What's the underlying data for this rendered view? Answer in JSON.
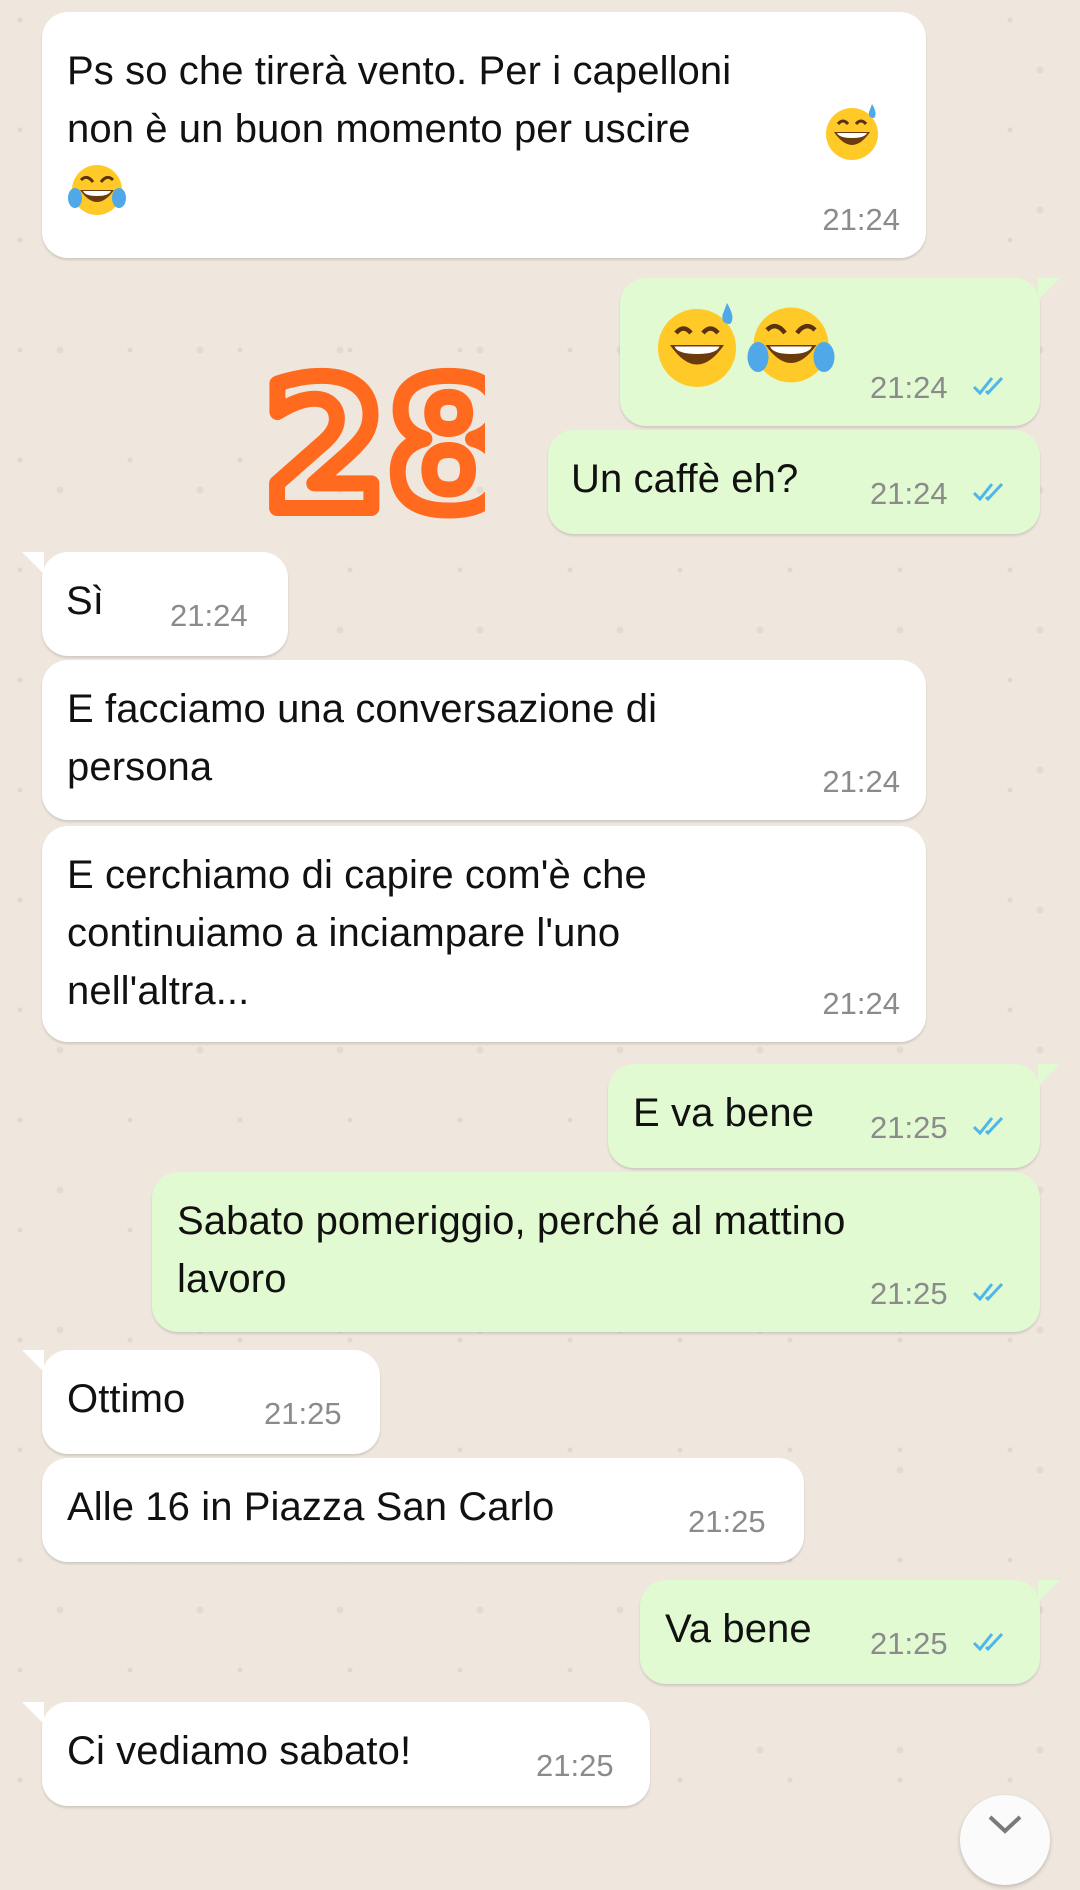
{
  "messages": [
    {
      "direction": "in",
      "text": "Ps so che tirerà vento. Per i capelloni\nnon è un buon momento per uscire",
      "time": "21:24"
    },
    {
      "direction": "out",
      "emoji": [
        "grinning-sweat-emoji",
        "tears-of-joy-emoji"
      ],
      "time": "21:24"
    },
    {
      "direction": "out",
      "text": "Un caffè eh?",
      "time": "21:24"
    },
    {
      "direction": "in",
      "text": "Sì",
      "time": "21:24"
    },
    {
      "direction": "in",
      "text": "E facciamo una conversazione di\npersona",
      "time": "21:24"
    },
    {
      "direction": "in",
      "text": "E cerchiamo di capire com'è che\ncontinuiamo a inciampare l'uno\nnell'altra...",
      "time": "21:24"
    },
    {
      "direction": "out",
      "text": "E va bene",
      "time": "21:25"
    },
    {
      "direction": "out",
      "text": "Sabato pomeriggio, perché al mattino\nlavoro",
      "time": "21:25"
    },
    {
      "direction": "in",
      "text": "Ottimo",
      "time": "21:25"
    },
    {
      "direction": "in",
      "text": "Alle 16 in Piazza San Carlo",
      "time": "21:25"
    },
    {
      "direction": "out",
      "text": "Va bene",
      "time": "21:25"
    },
    {
      "direction": "in",
      "text": "Ci vediamo sabato!",
      "time": "21:25"
    }
  ],
  "sticker": {
    "label": "28"
  },
  "colors": {
    "incoming_bubble": "#ffffff",
    "outgoing_bubble": "#e2fad2",
    "read_ticks": "#4fb6ec",
    "sticker": "#ff6a1f",
    "background": "#efe7de"
  },
  "icons": {
    "read_receipt": "double-check-icon",
    "scroll_down": "chevron-down-icon"
  }
}
